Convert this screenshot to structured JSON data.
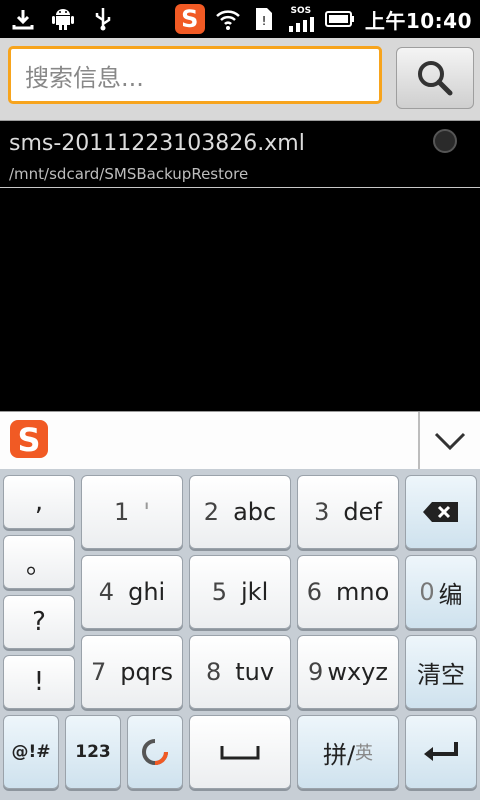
{
  "status_bar": {
    "icons": [
      "download-icon",
      "android-debug-icon",
      "usb-icon",
      "sogou-ime-icon",
      "wifi-icon",
      "sim-card-icon",
      "signal-sos-icon",
      "battery-icon"
    ],
    "sos_label": "SOS",
    "sogou_letter": "S",
    "time": "上午10:40"
  },
  "search": {
    "placeholder": "搜索信息..."
  },
  "list": {
    "items": [
      {
        "title": "sms-20111223103826.xml",
        "path": "/mnt/sdcard/SMSBackupRestore"
      }
    ]
  },
  "candidate_bar": {
    "logo_letter": "S"
  },
  "keyboard": {
    "punct": [
      ",",
      "。",
      "?",
      "!"
    ],
    "keys": {
      "k1_num": "1",
      "k1_letters": "'",
      "k2_num": "2",
      "k2_letters": "abc",
      "k3_num": "3",
      "k3_letters": "def",
      "k4_num": "4",
      "k4_letters": "ghi",
      "k5_num": "5",
      "k5_letters": "jkl",
      "k6_num": "6",
      "k6_letters": "mno",
      "k7_num": "7",
      "k7_letters": "pqrs",
      "k8_num": "8",
      "k8_letters": "tuv",
      "k9_num": "9",
      "k9_letters": "wxyz",
      "k0_num": "0",
      "k0_label": "编",
      "clear": "清空",
      "symbols": "@!#",
      "numbers": "123",
      "pinyin": "拼/",
      "pinyin_en": "英"
    },
    "accent_color": "#f15a24"
  }
}
